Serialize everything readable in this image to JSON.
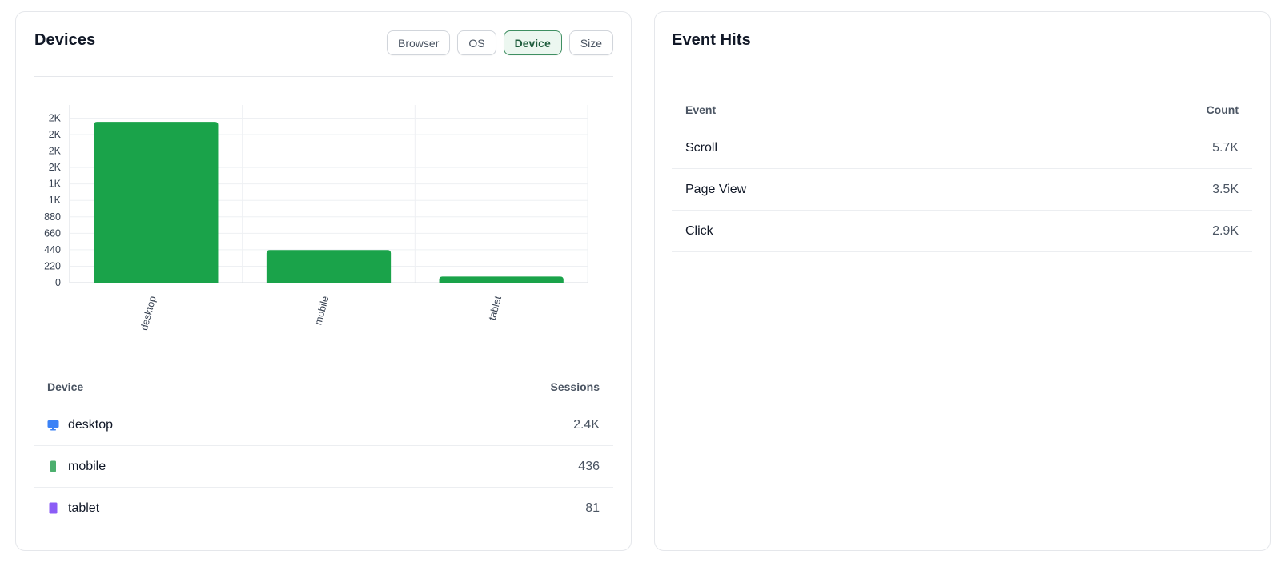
{
  "devices_card": {
    "title": "Devices",
    "tabs": [
      {
        "label": "Browser",
        "active": false
      },
      {
        "label": "OS",
        "active": false
      },
      {
        "label": "Device",
        "active": true
      },
      {
        "label": "Size",
        "active": false
      }
    ],
    "table": {
      "col_device": "Device",
      "col_sessions": "Sessions",
      "rows": [
        {
          "label": "desktop",
          "value": "2.4K",
          "icon": "desktop-icon",
          "icon_color": "#3b82f6"
        },
        {
          "label": "mobile",
          "value": "436",
          "icon": "mobile-icon",
          "icon_color": "#16a34a"
        },
        {
          "label": "tablet",
          "value": "81",
          "icon": "tablet-icon",
          "icon_color": "#8b5cf6"
        }
      ]
    }
  },
  "events_card": {
    "title": "Event Hits",
    "table": {
      "col_event": "Event",
      "col_count": "Count",
      "rows": [
        {
          "label": "Scroll",
          "value": "5.7K"
        },
        {
          "label": "Page View",
          "value": "3.5K"
        },
        {
          "label": "Click",
          "value": "2.9K"
        }
      ]
    }
  },
  "chart_data": {
    "type": "bar",
    "categories": [
      "desktop",
      "mobile",
      "tablet"
    ],
    "values": [
      2150,
      436,
      81
    ],
    "y_ticks": [
      0,
      220,
      440,
      660,
      880,
      1100,
      1320,
      1540,
      1760,
      1980,
      2200
    ],
    "y_tick_labels": [
      "0",
      "220",
      "440",
      "660",
      "880",
      "1K",
      "1K",
      "2K",
      "2K",
      "2K",
      "2K"
    ],
    "ylim": [
      0,
      2376
    ],
    "bar_color": "#1aa34a",
    "grid": true,
    "title": "",
    "xlabel": "",
    "ylabel": ""
  }
}
